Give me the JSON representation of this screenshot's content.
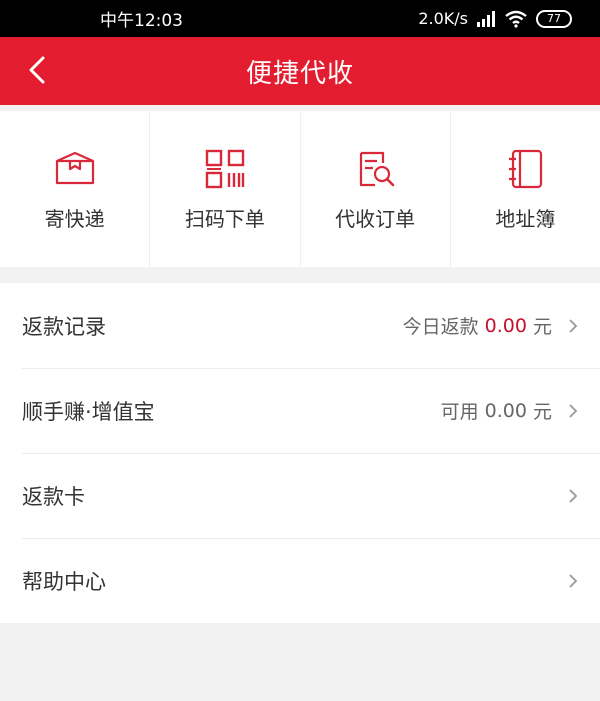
{
  "status_bar": {
    "time": "中午12:03",
    "network_speed": "2.0K/s",
    "battery": "77"
  },
  "header": {
    "title": "便捷代收"
  },
  "shortcuts": [
    {
      "label": "寄快递",
      "icon": "package-icon"
    },
    {
      "label": "扫码下单",
      "icon": "qr-code-icon"
    },
    {
      "label": "代收订单",
      "icon": "order-search-icon"
    },
    {
      "label": "地址簿",
      "icon": "address-book-icon"
    }
  ],
  "menu": {
    "refund_record": {
      "label": "返款记录",
      "prefix": "今日返款",
      "amount": "0.00",
      "unit": "元"
    },
    "zengzhibao": {
      "label": "顺手赚·增值宝",
      "prefix": "可用",
      "amount": "0.00",
      "unit": "元"
    },
    "refund_card": {
      "label": "返款卡"
    },
    "help": {
      "label": "帮助中心"
    }
  },
  "colors": {
    "brand_red": "#e41c2f",
    "amount_red": "#c8102e"
  }
}
